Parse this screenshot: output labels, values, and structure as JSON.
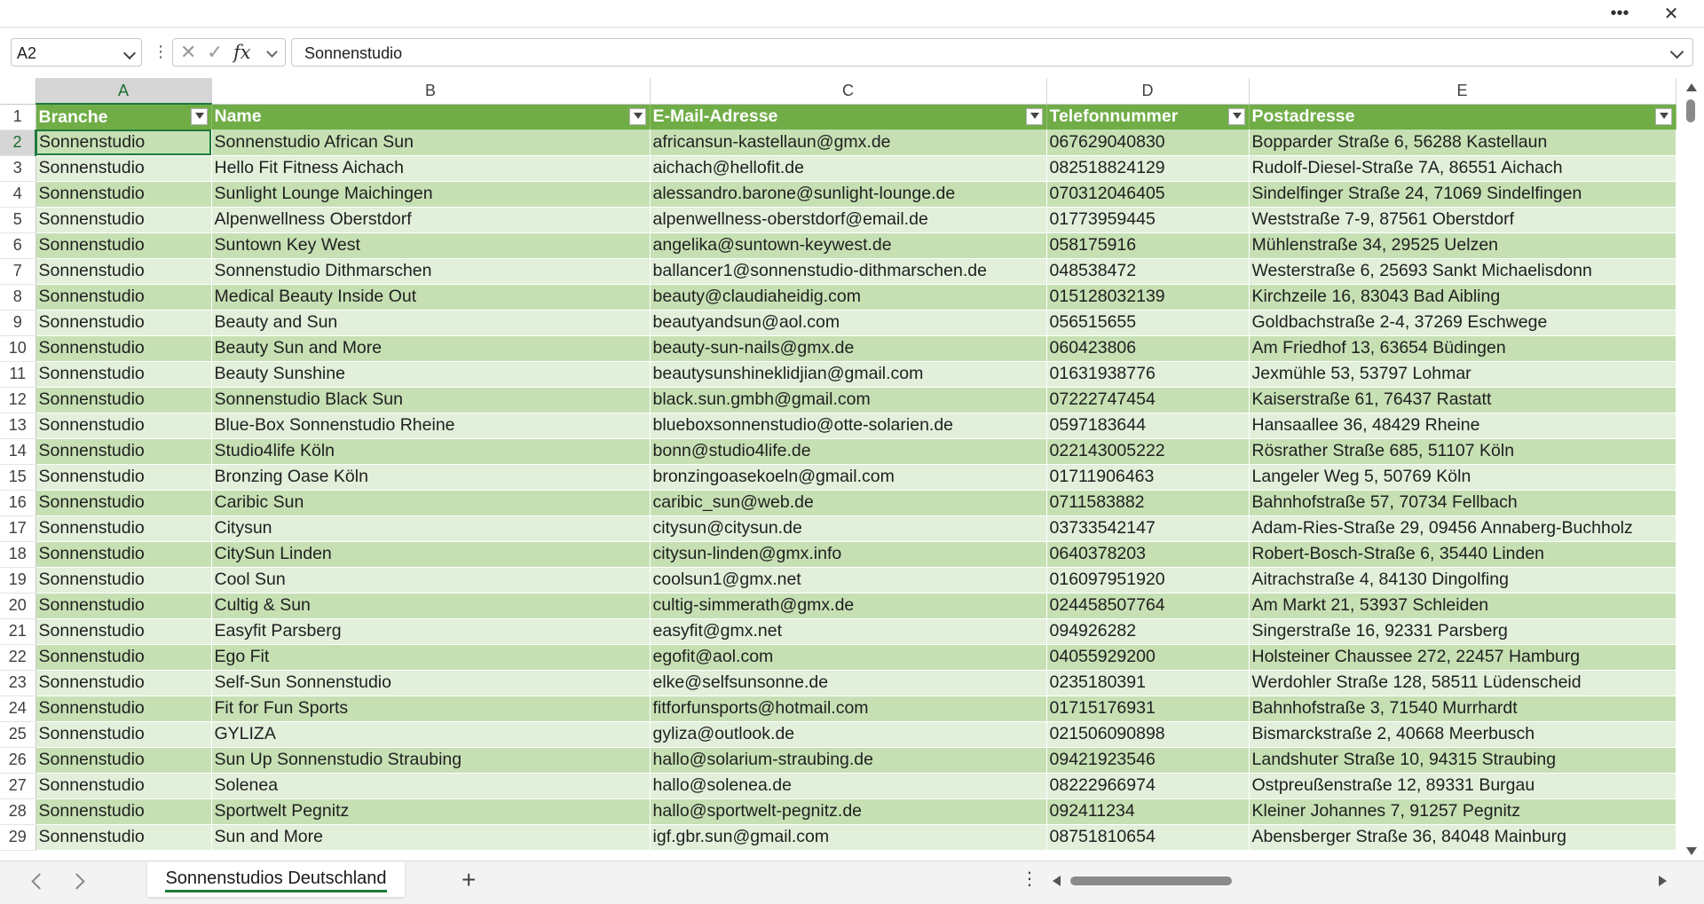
{
  "titlebar": {
    "more_icon": "more-horizontal-icon",
    "more_glyph": "•••",
    "close_glyph": "✕"
  },
  "formula_bar": {
    "name_box": "A2",
    "formula": "Sonnenstudio",
    "cancel_glyph": "✕",
    "enter_glyph": "✓",
    "fx_label": "fx"
  },
  "columns": [
    "A",
    "B",
    "C",
    "D",
    "E"
  ],
  "selected_column": "A",
  "header_row": {
    "num": "1",
    "cells": [
      "Branche",
      "Name",
      "E-Mail-Adresse",
      "Telefonnummer",
      "Postadresse"
    ]
  },
  "rows": [
    {
      "num": "2",
      "cells": [
        "Sonnenstudio",
        "Sonnenstudio African Sun",
        "africansun-kastellaun@gmx.de",
        "067629040830",
        "Bopparder Straße 6, 56288 Kastellaun"
      ]
    },
    {
      "num": "3",
      "cells": [
        "Sonnenstudio",
        "Hello Fit Fitness Aichach",
        "aichach@hellofit.de",
        "082518824129",
        "Rudolf-Diesel-Straße 7A, 86551 Aichach"
      ]
    },
    {
      "num": "4",
      "cells": [
        "Sonnenstudio",
        "Sunlight Lounge Maichingen",
        "alessandro.barone@sunlight-lounge.de",
        "070312046405",
        "Sindelfinger Straße 24, 71069 Sindelfingen"
      ]
    },
    {
      "num": "5",
      "cells": [
        "Sonnenstudio",
        "Alpenwellness Oberstdorf",
        "alpenwellness-oberstdorf@email.de",
        "01773959445",
        "Weststraße 7-9, 87561 Oberstdorf"
      ]
    },
    {
      "num": "6",
      "cells": [
        "Sonnenstudio",
        "Suntown Key West",
        "angelika@suntown-keywest.de",
        "058175916",
        "Mühlenstraße 34, 29525 Uelzen"
      ]
    },
    {
      "num": "7",
      "cells": [
        "Sonnenstudio",
        "Sonnenstudio Dithmarschen",
        "ballancer1@sonnenstudio-dithmarschen.de",
        "048538472",
        "Westerstraße 6, 25693 Sankt Michaelisdonn"
      ]
    },
    {
      "num": "8",
      "cells": [
        "Sonnenstudio",
        "Medical Beauty Inside Out",
        "beauty@claudiaheidig.com",
        "015128032139",
        "Kirchzeile 16, 83043 Bad Aibling"
      ]
    },
    {
      "num": "9",
      "cells": [
        "Sonnenstudio",
        "Beauty and Sun",
        "beautyandsun@aol.com",
        "056515655",
        "Goldbachstraße 2-4, 37269 Eschwege"
      ]
    },
    {
      "num": "10",
      "cells": [
        "Sonnenstudio",
        "Beauty Sun and More",
        "beauty-sun-nails@gmx.de",
        "060423806",
        "Am Friedhof 13, 63654 Büdingen"
      ]
    },
    {
      "num": "11",
      "cells": [
        "Sonnenstudio",
        "Beauty Sunshine",
        "beautysunshineklidjian@gmail.com",
        "01631938776",
        "Jexmühle 53, 53797 Lohmar"
      ]
    },
    {
      "num": "12",
      "cells": [
        "Sonnenstudio",
        "Sonnenstudio Black Sun",
        "black.sun.gmbh@gmail.com",
        "07222747454",
        "Kaiserstraße 61, 76437 Rastatt"
      ]
    },
    {
      "num": "13",
      "cells": [
        "Sonnenstudio",
        "Blue-Box Sonnenstudio Rheine",
        "blueboxsonnenstudio@otte-solarien.de",
        "0597183644",
        "Hansaallee 36, 48429 Rheine"
      ]
    },
    {
      "num": "14",
      "cells": [
        "Sonnenstudio",
        "Studio4life Köln",
        "bonn@studio4life.de",
        "022143005222",
        "Rösrather Straße 685, 51107 Köln"
      ]
    },
    {
      "num": "15",
      "cells": [
        "Sonnenstudio",
        "Bronzing Oase Köln",
        "bronzingoasekoeln@gmail.com",
        "01711906463",
        "Langeler Weg 5, 50769 Köln"
      ]
    },
    {
      "num": "16",
      "cells": [
        "Sonnenstudio",
        "Caribic Sun",
        "caribic_sun@web.de",
        "0711583882",
        "Bahnhofstraße 57, 70734 Fellbach"
      ]
    },
    {
      "num": "17",
      "cells": [
        "Sonnenstudio",
        "Citysun",
        "citysun@citysun.de",
        "03733542147",
        "Adam-Ries-Straße 29, 09456 Annaberg-Buchholz"
      ]
    },
    {
      "num": "18",
      "cells": [
        "Sonnenstudio",
        "CitySun Linden",
        "citysun-linden@gmx.info",
        "0640378203",
        "Robert-Bosch-Straße 6, 35440 Linden"
      ]
    },
    {
      "num": "19",
      "cells": [
        "Sonnenstudio",
        "Cool Sun",
        "coolsun1@gmx.net",
        "016097951920",
        "Aitrachstraße 4, 84130 Dingolfing"
      ]
    },
    {
      "num": "20",
      "cells": [
        "Sonnenstudio",
        "Cultig & Sun",
        "cultig-simmerath@gmx.de",
        "024458507764",
        "Am Markt 21, 53937 Schleiden"
      ]
    },
    {
      "num": "21",
      "cells": [
        "Sonnenstudio",
        "Easyfit Parsberg",
        "easyfit@gmx.net",
        "094926282",
        "Singerstraße 16, 92331 Parsberg"
      ]
    },
    {
      "num": "22",
      "cells": [
        "Sonnenstudio",
        "Ego Fit",
        "egofit@aol.com",
        "04055929200",
        "Holsteiner Chaussee 272, 22457 Hamburg"
      ]
    },
    {
      "num": "23",
      "cells": [
        "Sonnenstudio",
        "Self-Sun Sonnenstudio",
        "elke@selfsunsonne.de",
        "0235180391",
        "Werdohler Straße 128, 58511 Lüdenscheid"
      ]
    },
    {
      "num": "24",
      "cells": [
        "Sonnenstudio",
        "Fit for Fun Sports",
        "fitforfunsports@hotmail.com",
        "01715176931",
        "Bahnhofstraße 3, 71540 Murrhardt"
      ]
    },
    {
      "num": "25",
      "cells": [
        "Sonnenstudio",
        "GYLIZA",
        "gyliza@outlook.de",
        "021506090898",
        "Bismarckstraße 2, 40668 Meerbusch"
      ]
    },
    {
      "num": "26",
      "cells": [
        "Sonnenstudio",
        "Sun Up Sonnenstudio Straubing",
        "hallo@solarium-straubing.de",
        "09421923546",
        "Landshuter Straße 10, 94315 Straubing"
      ]
    },
    {
      "num": "27",
      "cells": [
        "Sonnenstudio",
        "Solenea",
        "hallo@solenea.de",
        "08222966974",
        "Ostpreußenstraße 12, 89331 Burgau"
      ]
    },
    {
      "num": "28",
      "cells": [
        "Sonnenstudio",
        "Sportwelt Pegnitz",
        "hallo@sportwelt-pegnitz.de",
        "092411234",
        "Kleiner Johannes 7, 91257 Pegnitz"
      ]
    },
    {
      "num": "29",
      "cells": [
        "Sonnenstudio",
        "Sun and More",
        "igf.gbr.sun@gmail.com",
        "08751810654",
        "Abensberger Straße 36, 84048 Mainburg"
      ]
    }
  ],
  "tabs": {
    "active": "Sonnenstudios Deutschland",
    "add_glyph": "+",
    "more_glyph": "⋮"
  },
  "colors": {
    "header_green": "#70ad47",
    "band_dark": "#c6e0b4",
    "band_light": "#e2efda",
    "selection": "#1f7a3d"
  }
}
